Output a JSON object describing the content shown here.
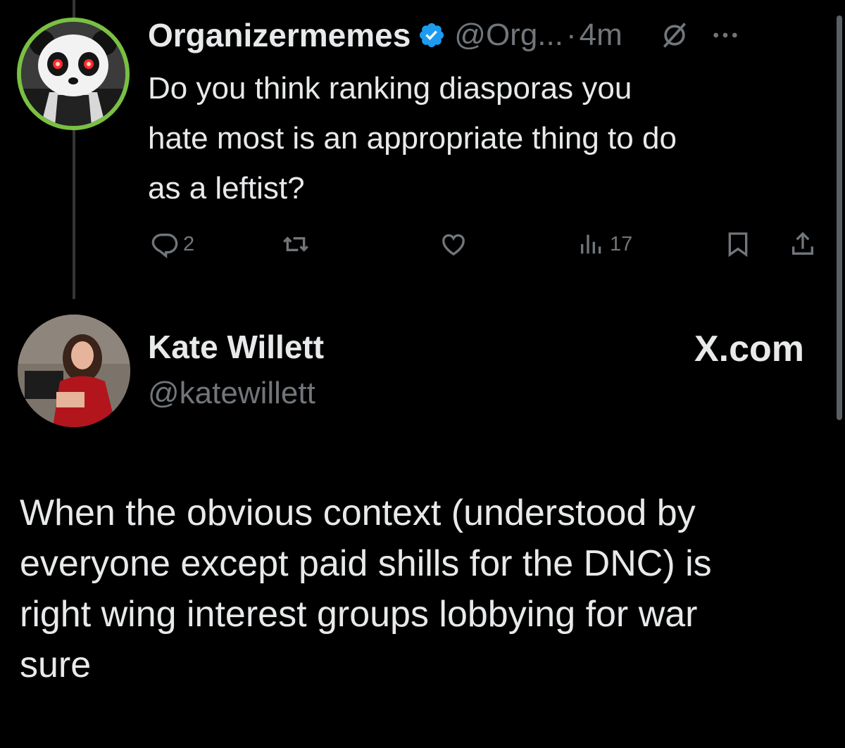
{
  "tweet1": {
    "author_name": "Organizermemes",
    "handle": "@Org...",
    "separator": "·",
    "time": "4m",
    "text_lines": [
      "Do you think ranking diasporas you",
      "hate most is an appropriate thing to do",
      "as a leftist?"
    ],
    "stats": {
      "replies": "2",
      "views": "17"
    },
    "colors": {
      "avatar_ring": "#79c043",
      "verified_badge": "#1d9bf0"
    },
    "icons": [
      "verified-badge-icon",
      "mute-icon",
      "more-icon",
      "reply-icon",
      "retweet-icon",
      "like-icon",
      "views-icon",
      "bookmark-icon",
      "share-icon"
    ]
  },
  "tweet2": {
    "author_name": "Kate Willett",
    "handle": "@katewillett",
    "source": "X.com",
    "text_lines": [
      "When the obvious context (understood by",
      "everyone except paid shills for the DNC) is",
      "right wing interest groups lobbying for war",
      "sure"
    ]
  }
}
